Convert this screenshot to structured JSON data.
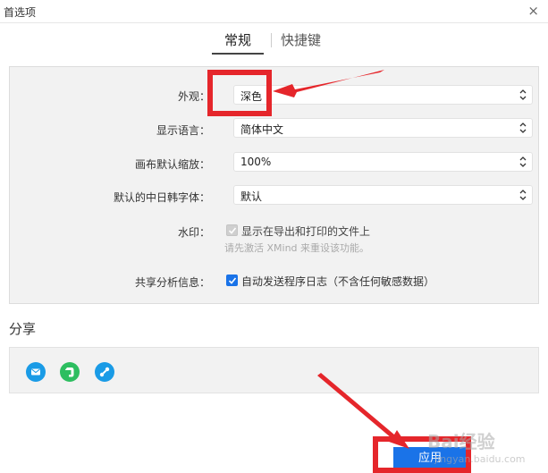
{
  "window": {
    "title": "首选项",
    "close_glyph": "×"
  },
  "tabs": [
    {
      "label": "常规",
      "active": true
    },
    {
      "label": "快捷键",
      "active": false
    }
  ],
  "general": {
    "appearance": {
      "label": "外观：",
      "value": "深色"
    },
    "language": {
      "label": "显示语言：",
      "value": "简体中文"
    },
    "zoom": {
      "label": "画布默认缩放：",
      "value": "100%"
    },
    "cjk_font": {
      "label": "默认的中日韩字体：",
      "value": "默认"
    },
    "watermark": {
      "label": "水印：",
      "checkbox_label": "显示在导出和打印的文件上",
      "checked": true,
      "disabled": true,
      "hint": "请先激活 XMind 来重设该功能。"
    },
    "analytics": {
      "label": "共享分析信息：",
      "checkbox_label": "自动发送程序日志（不含任何敏感数据）",
      "checked": true
    }
  },
  "share": {
    "title": "分享",
    "icons": [
      {
        "name": "mail-icon",
        "color": "#1a9be6"
      },
      {
        "name": "evernote-icon",
        "color": "#2dbe60"
      },
      {
        "name": "link-share-icon",
        "color": "#1a9be6"
      }
    ]
  },
  "footer": {
    "apply_label": "应用"
  },
  "watermark_overlay": {
    "text": "Bai经验",
    "sub": "jingyan.baidu.com"
  },
  "colors": {
    "accent": "#1a73e8",
    "annotation": "#e5262b",
    "panel": "#f2f2f2"
  }
}
